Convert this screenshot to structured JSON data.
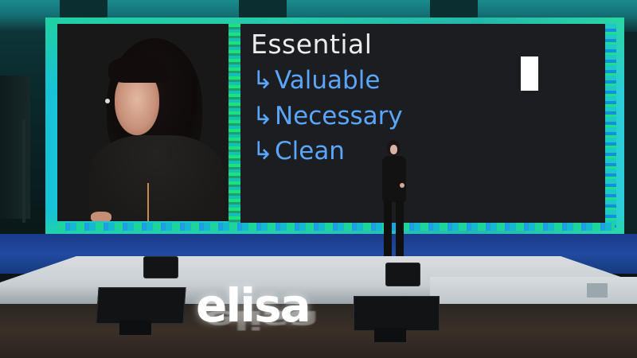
{
  "slide": {
    "title": "Essential",
    "arrow_glyph": "↳",
    "items": [
      "Valuable",
      "Necessary",
      "Clean"
    ]
  },
  "branding": {
    "logo_text": "elisa"
  },
  "colors": {
    "slide_title": "#ececec",
    "slide_items": "#5aa6ff",
    "screen_frame": "#1e8fe3",
    "stage_blue": "#214aa0"
  },
  "scene": {
    "type": "conference-stage",
    "elements": [
      "led-screen",
      "speaker-video-feed",
      "presentation-slide",
      "presenter",
      "stage-monitors",
      "illuminated-logo"
    ]
  }
}
